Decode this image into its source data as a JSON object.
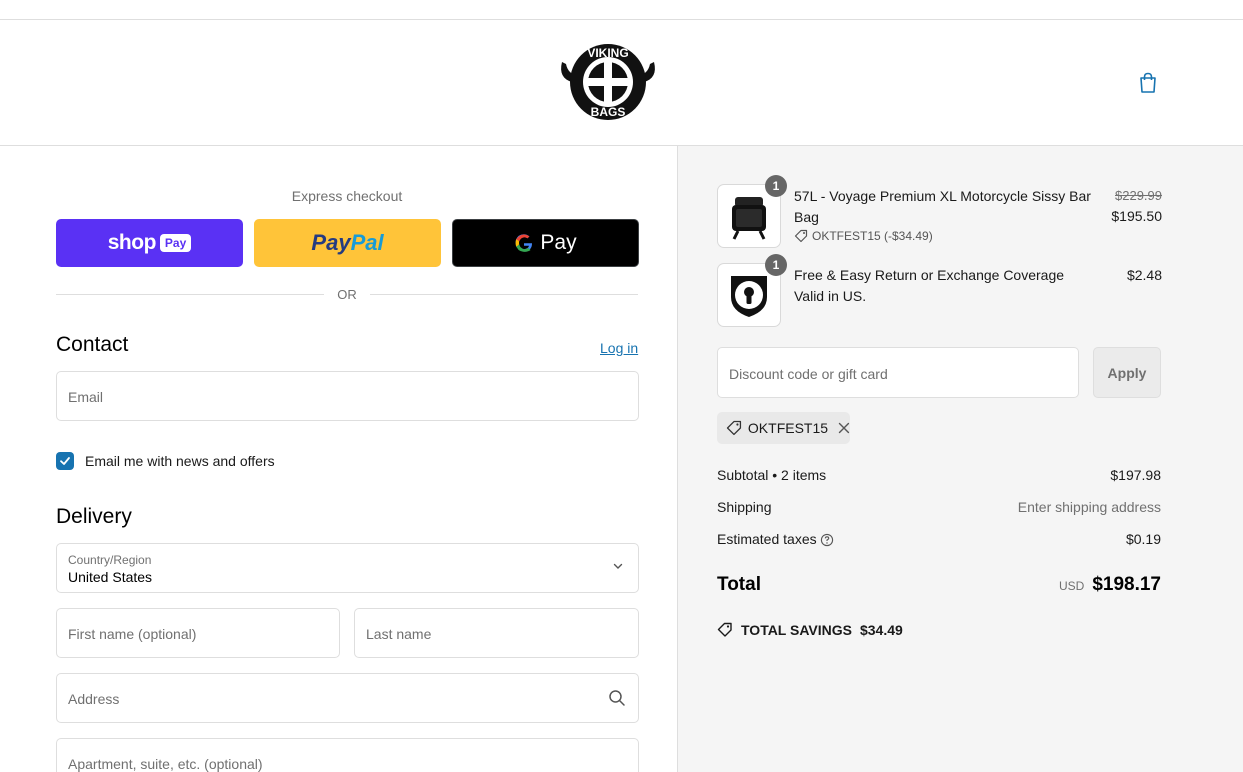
{
  "brand": {
    "logo_text_top": "VIKING",
    "logo_text_bottom": "BAGS"
  },
  "express": {
    "label": "Express checkout",
    "shop_pay": {
      "text": "shop",
      "badge": "Pay",
      "color": "#5a31f4"
    },
    "paypal": {
      "part1": "Pay",
      "part2": "Pal",
      "color": "#ffc439"
    },
    "gpay": {
      "text": "Pay",
      "color": "#000000"
    },
    "or_text": "OR"
  },
  "contact": {
    "title": "Contact",
    "login_label": "Log in",
    "email_placeholder": "Email",
    "newsletter_checked": true,
    "newsletter_label": "Email me with news and offers"
  },
  "delivery": {
    "title": "Delivery",
    "country_label": "Country/Region",
    "country_value": "United States",
    "first_name_placeholder": "First name (optional)",
    "last_name_placeholder": "Last name",
    "address_placeholder": "Address",
    "apartment_placeholder": "Apartment, suite, etc. (optional)"
  },
  "cart": {
    "items": [
      {
        "name": "57L - Voyage Premium XL Motorcycle Sissy Bar Bag",
        "quantity": "1",
        "discount": "OKTFEST15 (-$34.49)",
        "original_price": "$229.99",
        "price": "$195.50",
        "icon": "bag-icon"
      },
      {
        "name": "Free & Easy Return or Exchange Coverage Valid in US.",
        "quantity": "1",
        "price": "$2.48",
        "icon": "shield-lock-icon"
      }
    ]
  },
  "discount": {
    "placeholder": "Discount code or gift card",
    "apply_label": "Apply",
    "applied_code": "OKTFEST15"
  },
  "summary": {
    "subtotal_label": "Subtotal • 2 items",
    "subtotal_value": "$197.98",
    "shipping_label": "Shipping",
    "shipping_value": "Enter shipping address",
    "taxes_label": "Estimated taxes",
    "taxes_value": "$0.19",
    "total_label": "Total",
    "currency": "USD",
    "total_value": "$198.17",
    "savings_label": "TOTAL SAVINGS",
    "savings_value": "$34.49"
  },
  "colors": {
    "accent": "#1773b0",
    "summary_bg": "#f5f5f5",
    "border": "#dedede"
  }
}
